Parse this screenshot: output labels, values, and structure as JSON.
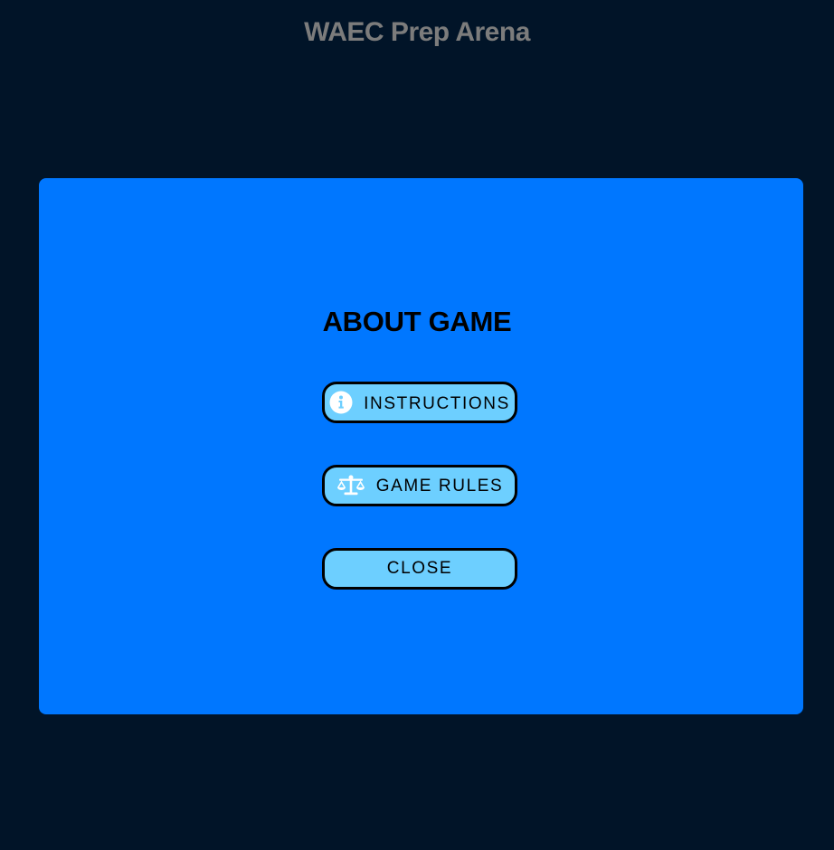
{
  "header": {
    "title": "WAEC Prep Arena"
  },
  "modal": {
    "title": "ABOUT GAME",
    "buttons": {
      "instructions": {
        "label": "INSTRUCTIONS",
        "icon": "info-circle-icon"
      },
      "game_rules": {
        "label": "GAME RULES",
        "icon": "scales-icon"
      },
      "close": {
        "label": "CLOSE"
      }
    }
  },
  "colors": {
    "background": "#011428",
    "modal": "#0077ff",
    "button": "#6dcfff",
    "title_text": "#7c7c7c"
  }
}
